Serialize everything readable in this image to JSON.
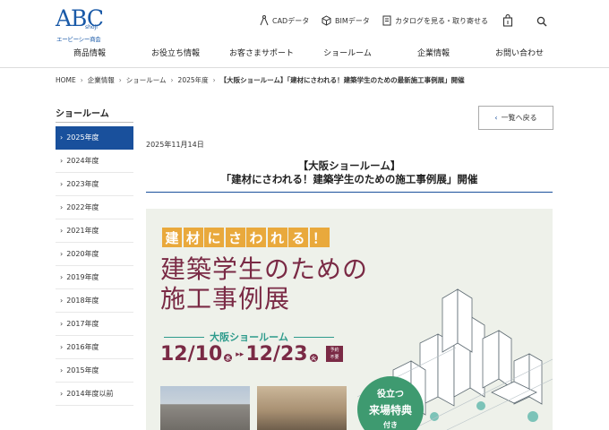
{
  "header": {
    "logo_text": "ABC",
    "logo_mark": "shoji",
    "logo_subtitle": "エービーシー商会",
    "utility_links": [
      {
        "label": "CADデータ",
        "icon": "compass-icon"
      },
      {
        "label": "BIMデータ",
        "icon": "bim-icon"
      },
      {
        "label": "カタログを見る・取り寄せる",
        "icon": "catalog-icon"
      }
    ],
    "icons": [
      "bag-icon",
      "search-icon"
    ]
  },
  "global_nav": [
    "商品情報",
    "お役立ち情報",
    "お客さまサポート",
    "ショールーム",
    "企業情報",
    "お問い合わせ"
  ],
  "breadcrumb": {
    "items": [
      "HOME",
      "企業情報",
      "ショールーム",
      "2025年度"
    ],
    "current": "【大阪ショールーム】「建材にさわれる！建築学生のための最新施工事例展」開催"
  },
  "sidebar": {
    "title": "ショールーム",
    "items": [
      "2025年度",
      "2024年度",
      "2023年度",
      "2022年度",
      "2021年度",
      "2020年度",
      "2019年度",
      "2018年度",
      "2017年度",
      "2016年度",
      "2015年度",
      "2014年度以前"
    ],
    "active_index": 0
  },
  "main": {
    "back_label": "一覧へ戻る",
    "date": "2025年11月14日",
    "title_line1": "【大阪ショールーム】",
    "title_line2": "「建材にさわれる！建築学生のための施工事例展」開催"
  },
  "banner": {
    "tagline_chars": [
      "建",
      "材",
      "に",
      "さ",
      "わ",
      "れ",
      "る",
      "！"
    ],
    "headline": "建築学生のための\n施工事例展",
    "venue": "大阪ショールーム",
    "date_start": "12/10",
    "date_start_dow": "水",
    "date_end": "12/23",
    "date_end_dow": "火",
    "badge_line1": "予約",
    "badge_line2": "不要",
    "perk_line1": "役立つ",
    "perk_line2": "来場特典",
    "perk_line3": "付き"
  },
  "colors": {
    "brand_blue": "#19509c",
    "accent_orange": "#e9a93c",
    "headline_maroon": "#7a2a45",
    "venue_teal": "#2e9b8c",
    "perk_green": "#3e9a70"
  }
}
